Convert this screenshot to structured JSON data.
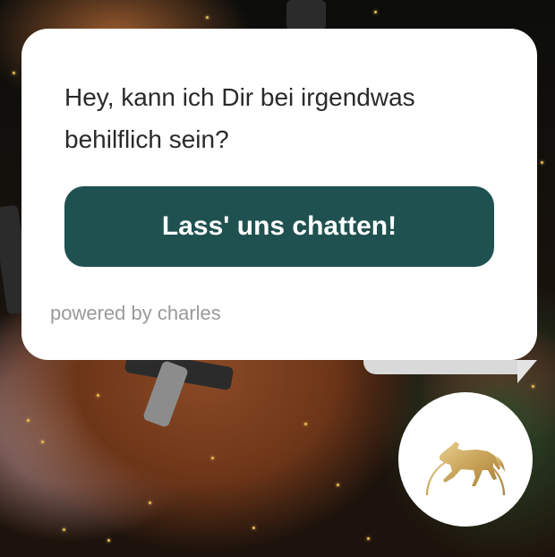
{
  "popup": {
    "message": "Hey, kann ich Dir bei irgendwas behilflich sein?",
    "chat_button_label": "Lass' uns chatten!",
    "powered_by": "powered by charles"
  },
  "launcher": {
    "icon": "horse-logo-icon"
  },
  "colors": {
    "button_background": "#1f5150",
    "button_text": "#ffffff",
    "message_text": "#2a2a2a",
    "powered_by_text": "#9a9a9a",
    "logo_gold": "#c9a45a"
  }
}
